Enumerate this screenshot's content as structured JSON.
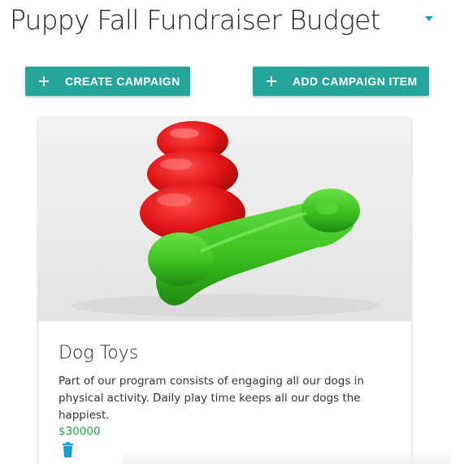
{
  "header": {
    "title": "Puppy Fall Fundraiser Budget",
    "dropdown_icon": "caret-down-icon",
    "accent_color": "#1a9ad9"
  },
  "toolbar": {
    "create_label": "CREATE CAMPAIGN",
    "add_item_label": "ADD CAMPAIGN ITEM",
    "button_icon": "plus-icon",
    "button_color": "#26a69a"
  },
  "campaign_items": [
    {
      "title": "Dog Toys",
      "description": "Part of our program consists of engaging all our dogs in physical activity. Daily play time keeps all our dogs the happiest.",
      "amount": "$30000",
      "amount_color": "#22a845",
      "image": "dog-toys-photo",
      "delete_icon": "trash-icon"
    }
  ]
}
